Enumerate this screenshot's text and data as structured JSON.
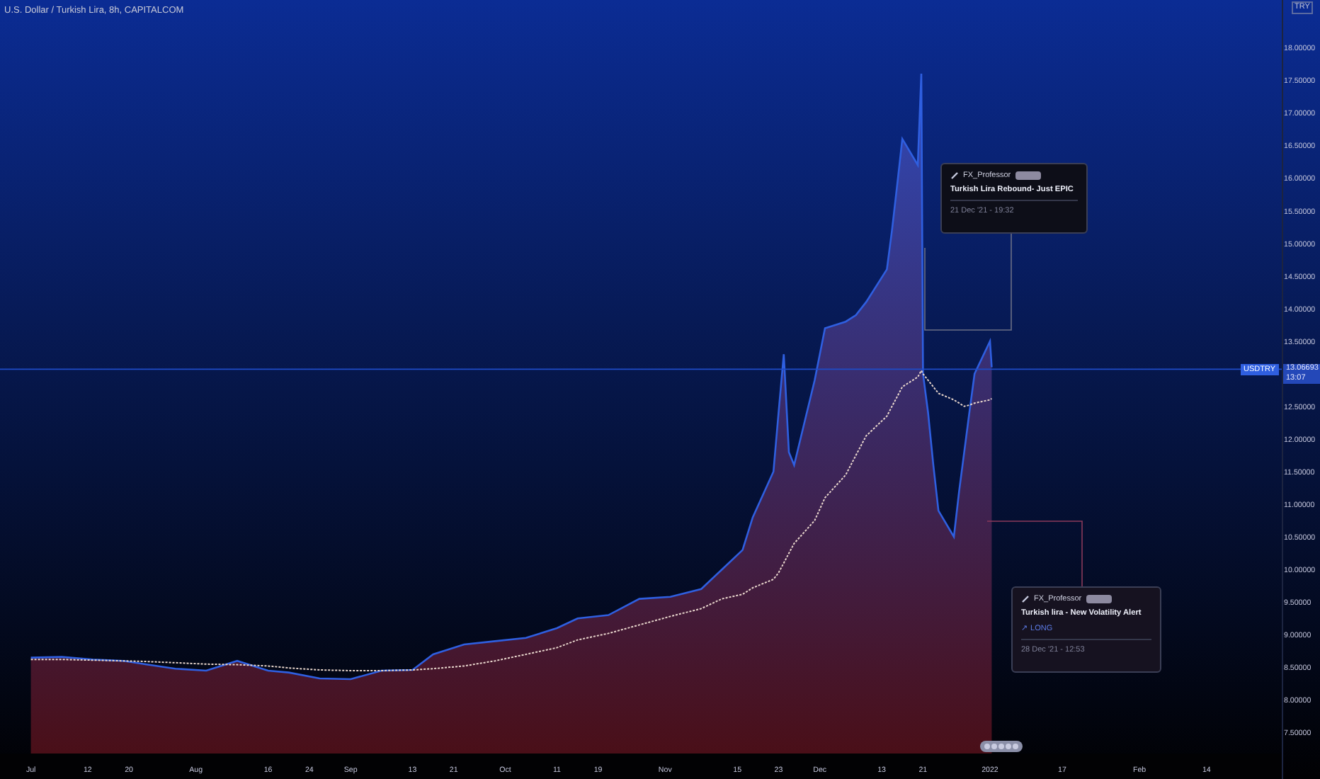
{
  "chart": {
    "title": "U.S. Dollar / Turkish Lira, 8h, CAPITALCOM",
    "currency": "TRY",
    "last_price": {
      "price": "13.06693",
      "countdown": "13:07"
    },
    "chart_data": {
      "type": "area",
      "x": [
        "2021-07-01",
        "2021-07-07",
        "2021-07-13",
        "2021-07-19",
        "2021-07-23",
        "2021-07-29",
        "2021-08-04",
        "2021-08-10",
        "2021-08-16",
        "2021-08-20",
        "2021-08-26",
        "2021-09-01",
        "2021-09-07",
        "2021-09-13",
        "2021-09-17",
        "2021-09-23",
        "2021-09-29",
        "2021-10-05",
        "2021-10-11",
        "2021-10-15",
        "2021-10-21",
        "2021-10-27",
        "2021-11-02",
        "2021-11-08",
        "2021-11-12",
        "2021-11-16",
        "2021-11-18",
        "2021-11-22",
        "2021-11-23",
        "2021-11-24",
        "2021-11-25",
        "2021-11-26",
        "2021-11-30",
        "2021-12-02",
        "2021-12-06",
        "2021-12-08",
        "2021-12-10",
        "2021-12-14",
        "2021-12-15",
        "2021-12-16",
        "2021-12-17",
        "2021-12-20",
        "2021-12-20T16:00",
        "2021-12-21",
        "2021-12-22",
        "2021-12-23",
        "2021-12-24",
        "2021-12-27",
        "2021-12-28",
        "2021-12-29",
        "2021-12-30",
        "2021-12-31",
        "2022-01-03",
        "2022-01-03T08:00"
      ],
      "series": [
        {
          "name": "USDTRY",
          "color": "#2f5fe0",
          "values": [
            8.65,
            8.66,
            8.62,
            8.6,
            8.55,
            8.48,
            8.45,
            8.6,
            8.45,
            8.42,
            8.33,
            8.32,
            8.45,
            8.46,
            8.7,
            8.85,
            8.9,
            8.95,
            9.1,
            9.25,
            9.3,
            9.55,
            9.58,
            9.7,
            10.0,
            10.3,
            10.8,
            11.5,
            12.4,
            13.3,
            11.8,
            11.6,
            12.9,
            13.7,
            13.8,
            13.9,
            14.1,
            14.6,
            15.2,
            15.9,
            16.6,
            16.2,
            17.6,
            13.0,
            12.4,
            11.6,
            10.9,
            10.5,
            11.2,
            11.8,
            12.4,
            13.0,
            13.5,
            13.1
          ]
        },
        {
          "type": "line",
          "line_style": "dotted",
          "color": "#e8d6cc",
          "values": [
            8.62,
            8.62,
            8.61,
            8.6,
            8.59,
            8.57,
            8.55,
            8.54,
            8.52,
            8.49,
            8.46,
            8.45,
            8.45,
            8.46,
            8.48,
            8.52,
            8.6,
            8.7,
            8.8,
            8.92,
            9.02,
            9.15,
            9.28,
            9.4,
            9.55,
            9.62,
            9.72,
            9.85,
            9.95,
            10.1,
            10.25,
            10.4,
            10.75,
            11.1,
            11.45,
            11.75,
            12.05,
            12.35,
            12.5,
            12.65,
            12.8,
            12.95,
            13.05,
            13.0,
            12.9,
            12.8,
            12.7,
            12.6,
            12.55,
            12.5,
            12.52,
            12.55,
            12.6,
            12.62
          ]
        }
      ],
      "xlim": [
        "2021-06-25",
        "2022-03-08"
      ],
      "ylim": [
        6.81,
        18.73
      ],
      "ref_lines": [
        {
          "axis": "y",
          "value": 13.07,
          "color": "#1f4cc8"
        }
      ],
      "xticks": [
        {
          "value": "2021-07-01",
          "label": "Jul"
        },
        {
          "value": "2021-07-12",
          "label": "12"
        },
        {
          "value": "2021-07-20",
          "label": "20"
        },
        {
          "value": "2021-08-02",
          "label": "Aug"
        },
        {
          "value": "2021-08-16",
          "label": "16"
        },
        {
          "value": "2021-08-24",
          "label": "24"
        },
        {
          "value": "2021-09-01",
          "label": "Sep"
        },
        {
          "value": "2021-09-13",
          "label": "13"
        },
        {
          "value": "2021-09-21",
          "label": "21"
        },
        {
          "value": "2021-10-01",
          "label": "Oct"
        },
        {
          "value": "2021-10-11",
          "label": "11"
        },
        {
          "value": "2021-10-19",
          "label": "19"
        },
        {
          "value": "2021-11-01",
          "label": "Nov"
        },
        {
          "value": "2021-11-15",
          "label": "15"
        },
        {
          "value": "2021-11-23",
          "label": "23"
        },
        {
          "value": "2021-12-01",
          "label": "Dec"
        },
        {
          "value": "2021-12-13",
          "label": "13"
        },
        {
          "value": "2021-12-21",
          "label": "21"
        },
        {
          "value": "2022-01-03",
          "label": "2022"
        },
        {
          "value": "2022-01-17",
          "label": "17"
        },
        {
          "value": "2022-02-01",
          "label": "Feb"
        },
        {
          "value": "2022-02-14",
          "label": "14"
        }
      ],
      "yticks": [
        {
          "value": 7.5,
          "label": "7.50000"
        },
        {
          "value": 8,
          "label": "8.00000"
        },
        {
          "value": 8.5,
          "label": "8.50000"
        },
        {
          "value": 9,
          "label": "9.00000"
        },
        {
          "value": 9.5,
          "label": "9.50000"
        },
        {
          "value": 10,
          "label": "10.00000"
        },
        {
          "value": 10.5,
          "label": "10.50000"
        },
        {
          "value": 11,
          "label": "11.00000"
        },
        {
          "value": 11.5,
          "label": "11.50000"
        },
        {
          "value": 12,
          "label": "12.00000"
        },
        {
          "value": 12.5,
          "label": "12.50000"
        },
        {
          "value": 13.5,
          "label": "13.50000"
        },
        {
          "value": 14,
          "label": "14.00000"
        },
        {
          "value": 14.5,
          "label": "14.50000"
        },
        {
          "value": 15,
          "label": "15.00000"
        },
        {
          "value": 15.5,
          "label": "15.50000"
        },
        {
          "value": 16,
          "label": "16.00000"
        },
        {
          "value": 16.5,
          "label": "16.50000"
        },
        {
          "value": 17,
          "label": "17.00000"
        },
        {
          "value": 17.5,
          "label": "17.50000"
        },
        {
          "value": 18,
          "label": "18.00000"
        }
      ]
    }
  },
  "ideas": [
    {
      "author": "FX_Professor",
      "title": "Turkish Lira Rebound- Just EPIC",
      "date": "21 Dec '21 - 19:32"
    },
    {
      "author": "FX_Professor",
      "title": "Turkish lira - New Volatility Alert",
      "signal": "↗ LONG",
      "date": "28 Dec '21 - 12:53"
    }
  ]
}
